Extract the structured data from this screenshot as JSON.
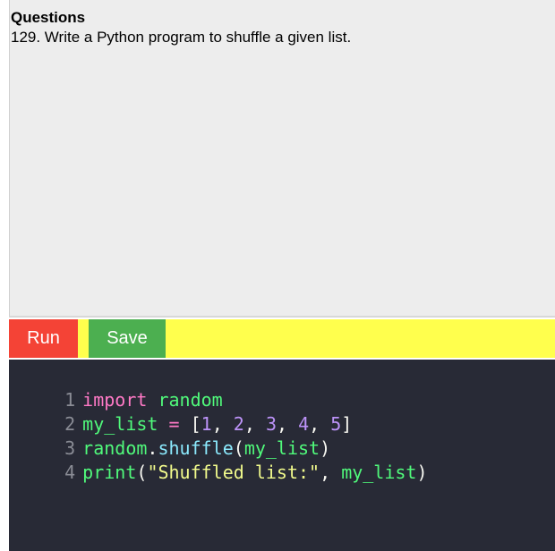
{
  "question": {
    "heading": "Questions",
    "text": "129. Write a Python program to shuffle a given list."
  },
  "toolbar": {
    "run_label": "Run",
    "save_label": "Save",
    "accent_color": "#ffff4d",
    "run_color": "#f44336",
    "save_color": "#4caf50"
  },
  "editor": {
    "background": "#282a36",
    "lines": [
      {
        "number": "1",
        "tokens": [
          "import",
          " ",
          "random"
        ]
      },
      {
        "number": "2",
        "tokens": [
          "my_list",
          " ",
          "=",
          " ",
          "[",
          "1",
          ", ",
          "2",
          ", ",
          "3",
          ", ",
          "4",
          ", ",
          "5",
          "]"
        ]
      },
      {
        "number": "3",
        "tokens": [
          "random",
          ".",
          "shuffle",
          "(",
          "my_list",
          ")"
        ]
      },
      {
        "number": "4",
        "tokens": [
          "print",
          "(",
          "\"Shuffled list:\"",
          ", ",
          "my_list",
          ")"
        ]
      }
    ]
  }
}
